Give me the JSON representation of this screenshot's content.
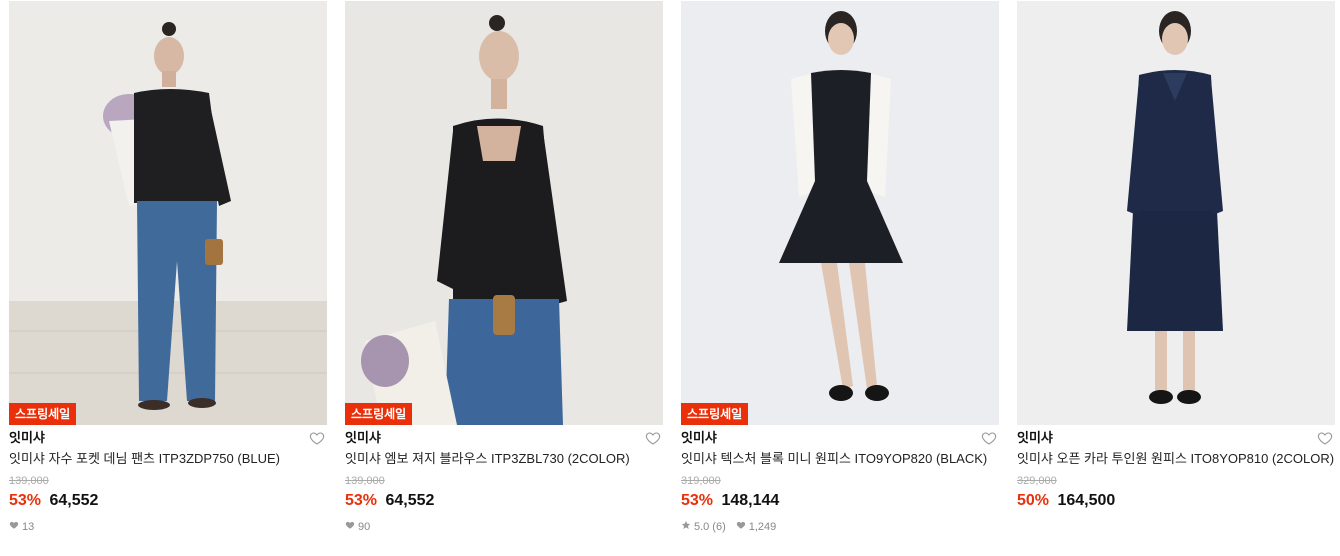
{
  "products": [
    {
      "badge": "스프링세일",
      "brand": "잇미샤",
      "name": "잇미샤 자수 포켓 데님 팬츠 ITP3ZDP750 (BLUE)",
      "original_price": "139,000",
      "discount": "53%",
      "price": "64,552",
      "likes": "13",
      "rating": "",
      "reviews": ""
    },
    {
      "badge": "스프링세일",
      "brand": "잇미샤",
      "name": "잇미샤 엠보 져지 블라우스 ITP3ZBL730 (2COLOR)",
      "original_price": "139,000",
      "discount": "53%",
      "price": "64,552",
      "likes": "90",
      "rating": "",
      "reviews": ""
    },
    {
      "badge": "스프링세일",
      "brand": "잇미샤",
      "name": "잇미샤 텍스처 블록 미니 원피스 ITO9YOP820 (BLACK)",
      "original_price": "319,000",
      "discount": "53%",
      "price": "148,144",
      "likes": "1,249",
      "rating": "5.0",
      "reviews": "(6)"
    },
    {
      "badge": "",
      "brand": "잇미샤",
      "name": "잇미샤 오픈 카라 투인원 원피스 ITO8YOP810 (2COLOR)",
      "original_price": "329,000",
      "discount": "50%",
      "price": "164,500",
      "likes": "",
      "rating": "",
      "reviews": ""
    }
  ],
  "colors": {
    "accent": "#e9300a",
    "muted": "#888888",
    "strike": "#aaaaaa"
  },
  "icons": {
    "like": "heart-outline-icon",
    "likes_count": "heart-filled-icon",
    "rating": "star-icon"
  }
}
